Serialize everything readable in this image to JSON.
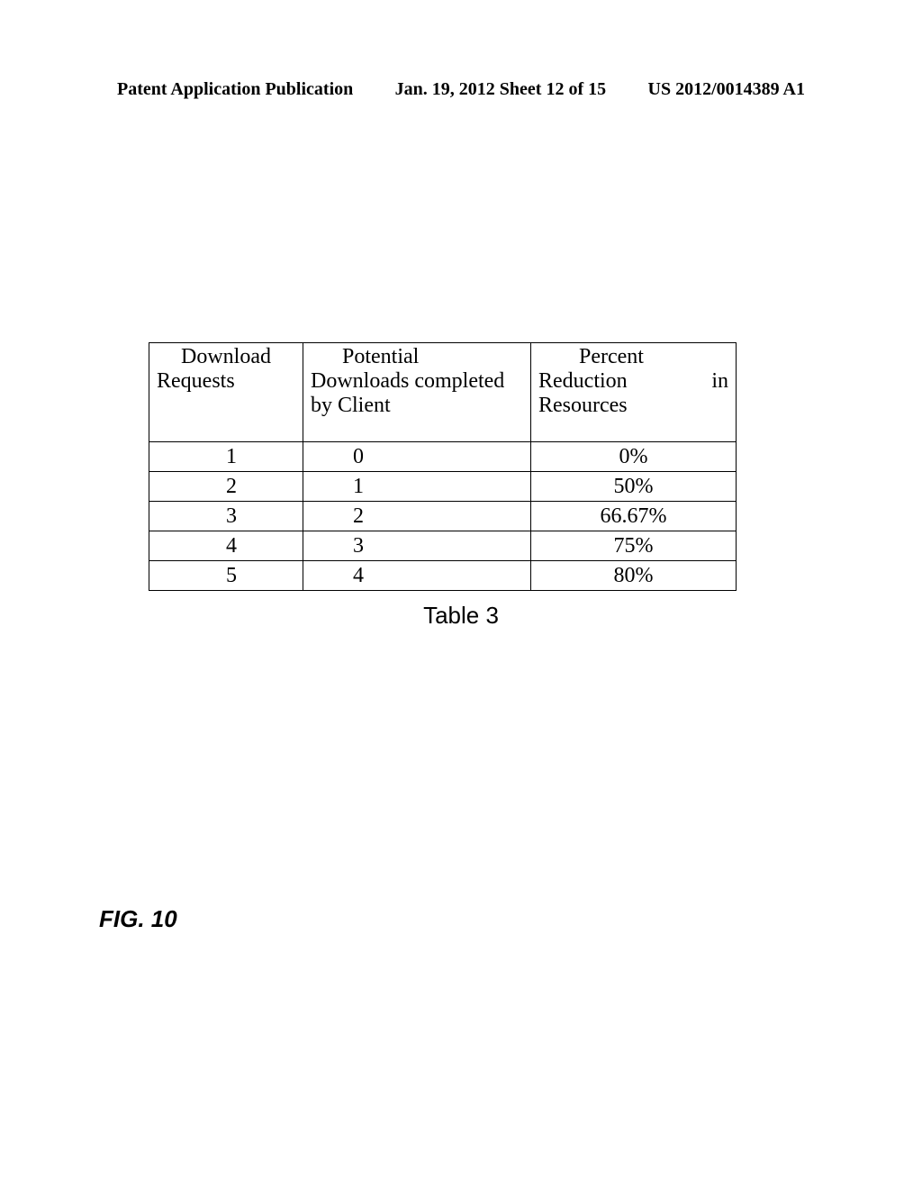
{
  "header": {
    "left": "Patent Application Publication",
    "center": "Jan. 19, 2012  Sheet 12 of 15",
    "right": "US 2012/0014389 A1"
  },
  "chart_data": {
    "type": "table",
    "title": "Table 3",
    "columns": [
      "Download Requests",
      "Potential Downloads completed by Client",
      "Percent Reduction in Resources"
    ],
    "rows": [
      {
        "requests": "1",
        "completed": "0",
        "reduction": "0%"
      },
      {
        "requests": "2",
        "completed": "1",
        "reduction": "50%"
      },
      {
        "requests": "3",
        "completed": "2",
        "reduction": "66.67%"
      },
      {
        "requests": "4",
        "completed": "3",
        "reduction": "75%"
      },
      {
        "requests": "5",
        "completed": "4",
        "reduction": "80%"
      }
    ]
  },
  "table_header": {
    "col1_line1": "Download",
    "col1_line2": "Requests",
    "col2_line1": "Potential",
    "col2_line2": "Downloads  completed",
    "col2_line3": "by Client",
    "col3_line1": "Percent",
    "col3_line2a": "Reduction",
    "col3_line2b": "in",
    "col3_line3": "Resources"
  },
  "figure_label": "FIG. 10"
}
